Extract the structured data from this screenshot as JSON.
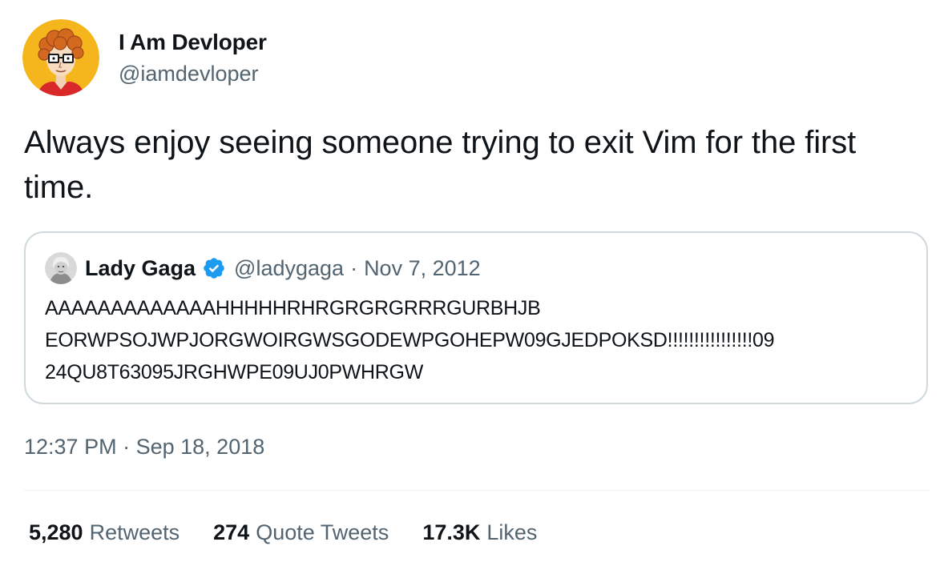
{
  "author": {
    "display_name": "I Am Devloper",
    "handle": "@iamdevloper",
    "avatar_icon": "cartoon-developer-avatar"
  },
  "tweet": {
    "text": "Always enjoy seeing someone trying to exit Vim for the first time."
  },
  "quoted_tweet": {
    "display_name": "Lady Gaga",
    "verified": true,
    "verified_icon": "verified-badge-icon",
    "handle": "@ladygaga",
    "separator": "·",
    "date": "Nov 7, 2012",
    "text_lines": [
      "AAAAAAAAAAAAAHHHHHRHRGRGRGRRRGURBHJB",
      "EORWPSOJWPJORGWOIRGWSGODEWPGOHEPW09GJEDPOKSD!!!!!!!!!!!!!!!!09",
      "24QU8T63095JRGHWPE09UJ0PWHRGW"
    ]
  },
  "meta": {
    "time": "12:37 PM",
    "separator": "·",
    "date": "Sep 18, 2018"
  },
  "stats": {
    "retweets": {
      "count": "5,280",
      "label": "Retweets"
    },
    "quote_tweets": {
      "count": "274",
      "label": "Quote Tweets"
    },
    "likes": {
      "count": "17.3K",
      "label": "Likes"
    }
  },
  "colors": {
    "text_primary": "#0f1419",
    "text_secondary": "#536471",
    "border": "#cfd9de",
    "verified_blue": "#1d9bf0",
    "avatar_background": "#f5b51c"
  }
}
